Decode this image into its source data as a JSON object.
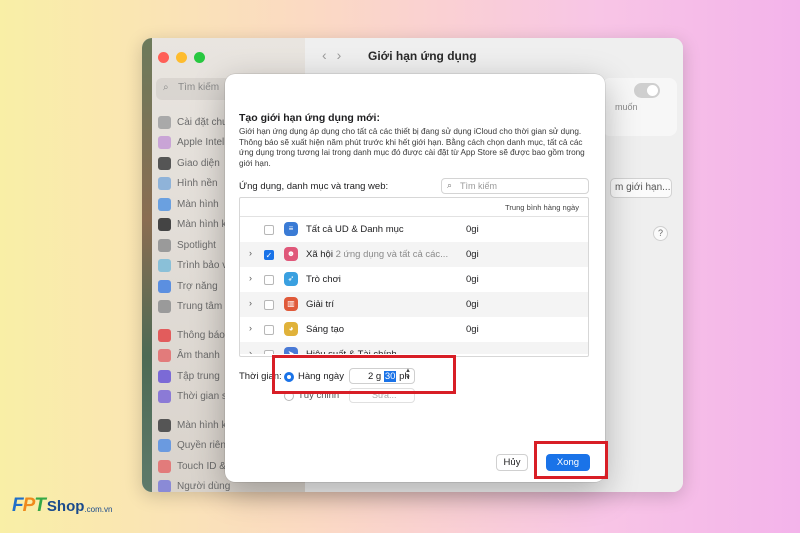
{
  "background_window": {
    "title": "Giới hạn ứng dụng",
    "search_placeholder": "Tìm kiếm",
    "sidebar_items": [
      {
        "label": "Cài đặt chung",
        "color": "#a9a9a9"
      },
      {
        "label": "Apple Intelligence",
        "color": "#c9a4d6"
      },
      {
        "label": "Giao diện",
        "color": "#555555"
      },
      {
        "label": "Hình nền",
        "color": "#8fb3d9"
      },
      {
        "label": "Màn hình",
        "color": "#6aa0e0"
      },
      {
        "label": "Màn hình khóa",
        "color": "#444444"
      },
      {
        "label": "Spotlight",
        "color": "#9a9a9a"
      },
      {
        "label": "Trình bảo vệ",
        "color": "#8ac0d8"
      },
      {
        "label": "Trợ năng",
        "color": "#5b8fe0"
      },
      {
        "label": "Trung tâm điều khiển",
        "color": "#9a9a9a"
      },
      {
        "label": "Thông báo",
        "color": "#e25c5c"
      },
      {
        "label": "Âm thanh",
        "color": "#e27b7b"
      },
      {
        "label": "Tập trung",
        "color": "#7b6ad6"
      },
      {
        "label": "Thời gian sử dụng",
        "color": "#8b7ad6"
      },
      {
        "label": "Màn hình khóa",
        "color": "#555555"
      },
      {
        "label": "Quyền riêng tư",
        "color": "#6a9ae0"
      },
      {
        "label": "Touch ID & Mật khẩu",
        "color": "#e27b7b"
      },
      {
        "label": "Người dùng",
        "color": "#8a8ad6"
      }
    ],
    "card_text": "muốn",
    "add_limit_button": "m giới hạn...",
    "help_icon": "?"
  },
  "dialog": {
    "title": "Tạo giới hạn ứng dụng mới:",
    "description": "Giới hạn ứng dụng áp dụng cho tất cả các thiết bị đang sử dụng iCloud cho thời gian sử dụng. Thông báo sẽ xuất hiện năm phút trước khi hết giới hạn. Bằng cách chọn danh mục, tất cả các ứng dụng trong tương lai trong danh mục đó được cài đặt từ App Store sẽ được bao gồm trong giới hạn.",
    "list_label": "Ứng dụng, danh mục và trang web:",
    "search_placeholder": "Tìm kiếm",
    "table_header": "Trung bình hàng ngày",
    "rows": [
      {
        "name": "Tất cả UD & Danh mục",
        "sub": "",
        "time": "0gi",
        "checked": false,
        "expand": false,
        "icon": "stack-icon",
        "glyph": "≡",
        "color": "#3a7bd5"
      },
      {
        "name": "Xã hội",
        "sub": " 2 ứng dụng và tất cả các...",
        "time": "0gi",
        "checked": true,
        "expand": true,
        "icon": "social-icon",
        "glyph": "☻",
        "color": "#e0587a"
      },
      {
        "name": "Trò chơi",
        "sub": "",
        "time": "0gi",
        "checked": false,
        "expand": true,
        "icon": "rocket-icon",
        "glyph": "➶",
        "color": "#3aa0e0"
      },
      {
        "name": "Giải trí",
        "sub": "",
        "time": "0gi",
        "checked": false,
        "expand": true,
        "icon": "popcorn-icon",
        "glyph": "▥",
        "color": "#e05a3a"
      },
      {
        "name": "Sáng tạo",
        "sub": "",
        "time": "0gi",
        "checked": false,
        "expand": true,
        "icon": "palette-icon",
        "glyph": "◕",
        "color": "#e0b23a"
      },
      {
        "name": "Hiệu suất & Tài chính",
        "sub": "",
        "time": "",
        "checked": false,
        "expand": true,
        "icon": "productivity-icon",
        "glyph": "➤",
        "color": "#4a7ad6"
      }
    ],
    "time_label": "Thời gian:",
    "daily_label": "Hàng ngày",
    "hours_value": "2 g",
    "minutes_value": "30",
    "minutes_unit": " ph",
    "custom_label": "Tùy chỉnh",
    "edit_button": "Sửa...",
    "cancel_button": "Hủy",
    "done_button": "Xong"
  },
  "logo": {
    "f": "F",
    "p": "P",
    "t": "T",
    "shop": "Shop",
    "domain": ".com.vn"
  },
  "colors": {
    "accent": "#1a73e8",
    "highlight_box": "#d81e26"
  }
}
